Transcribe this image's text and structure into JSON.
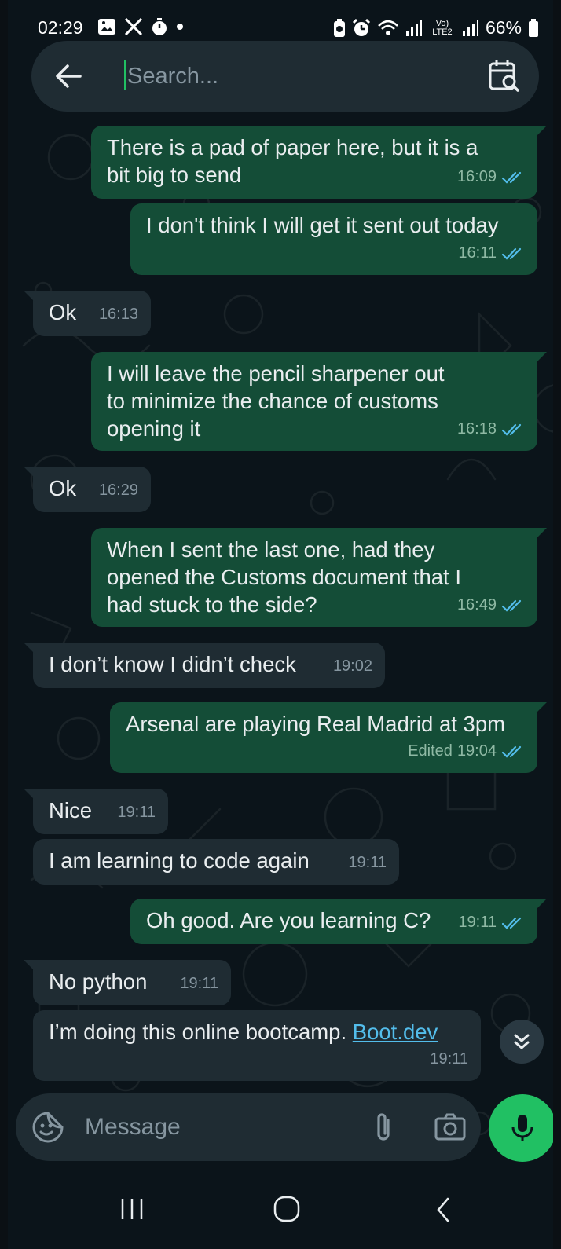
{
  "status_bar": {
    "time": "02:29",
    "battery_percent": "66%",
    "network_label": "Vo) LTE2",
    "left_icons": [
      "gallery-icon",
      "x-logo-icon",
      "timer-icon",
      "dot-icon"
    ],
    "right_icons": [
      "battery-saver-icon",
      "alarm-icon",
      "wifi-icon",
      "signal-icon",
      "volte-icon",
      "signal-icon",
      "battery-icon"
    ]
  },
  "search": {
    "placeholder": "Search...",
    "back_icon": "arrow-left-icon",
    "calendar_icon": "calendar-search-icon"
  },
  "messages": [
    {
      "direction": "out",
      "text": "There is a pad of paper here, but it is a\nbit big to send",
      "time": "16:09",
      "status": "read"
    },
    {
      "direction": "out",
      "text": "I don't think I will get it sent out today",
      "time": "16:11",
      "status": "read"
    },
    {
      "direction": "in",
      "text": "Ok",
      "time": "16:13"
    },
    {
      "direction": "out",
      "text": "I will leave the pencil sharpener out\nto minimize the chance of customs\nopening it",
      "time": "16:18",
      "status": "read"
    },
    {
      "direction": "in",
      "text": "Ok",
      "time": "16:29"
    },
    {
      "direction": "out",
      "text": "When I sent the last one, had they\nopened the Customs document that I\nhad stuck to the side?",
      "time": "16:49",
      "status": "read"
    },
    {
      "direction": "in",
      "text": "I don’t know I didn’t check",
      "time": "19:02"
    },
    {
      "direction": "out",
      "text": "Arsenal are playing Real Madrid at 3pm",
      "edited_label": "Edited",
      "time": "19:04",
      "status": "read"
    },
    {
      "direction": "in",
      "text": "Nice",
      "time": "19:11"
    },
    {
      "direction": "in",
      "text": "I am learning to code again",
      "time": "19:11"
    },
    {
      "direction": "out",
      "text": "Oh good. Are you learning C?",
      "time": "19:11",
      "status": "read"
    },
    {
      "direction": "in",
      "text": "No python",
      "time": "19:11"
    },
    {
      "direction": "in",
      "text": "I’m doing this online bootcamp. ",
      "link": "Boot.dev",
      "time": "19:11"
    }
  ],
  "composer": {
    "placeholder": "Message",
    "emoji_icon": "sticker-emoji-icon",
    "attach_icon": "paperclip-icon",
    "camera_icon": "camera-icon",
    "mic_icon": "microphone-icon"
  },
  "scroll_button_icon": "double-chevron-down-icon",
  "nav_bar": [
    "recents-icon",
    "home-icon",
    "back-icon"
  ],
  "colors": {
    "background": "#0b141a",
    "outgoing_bubble": "#144d37",
    "incoming_bubble": "#1f2c33",
    "accent_green": "#21c063",
    "read_ticks": "#53bdeb",
    "link": "#53bdeb"
  }
}
